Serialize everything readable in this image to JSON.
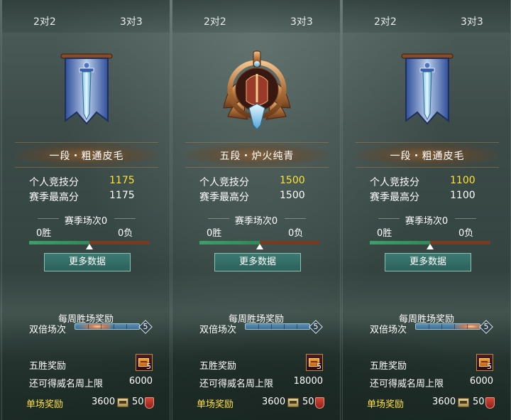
{
  "panels": [
    {
      "tabs": [
        "2对2",
        "3对3"
      ],
      "emblem": "banner-sword-emblem-icon",
      "rank_name": "一段・粗通皮毛",
      "personal_score_label": "个人竞技分",
      "personal_score": "1175",
      "season_best_label": "赛季最高分",
      "season_best": "1175",
      "season_matches": "赛季场次0",
      "wins": "0胜",
      "losses": "0负",
      "more_button": "更多数据",
      "weekly_title": "每周胜场奖励",
      "double_label": "双倍场次",
      "double_count": "5",
      "five_win_label": "五胜奖励",
      "chest_count": "5",
      "limit_label": "还可得威名周上限",
      "limit_value": "6000",
      "single_label": "单场奖励",
      "single_value1": "3600",
      "single_value2": "50"
    },
    {
      "tabs": [
        "2对2",
        "3对3"
      ],
      "emblem": "winged-bronze-emblem-icon",
      "rank_name": "五段・炉火纯青",
      "personal_score_label": "个人竞技分",
      "personal_score": "1500",
      "season_best_label": "赛季最高分",
      "season_best": "1500",
      "season_matches": "赛季场次0",
      "wins": "0胜",
      "losses": "0负",
      "more_button": "更多数据",
      "weekly_title": "每周胜场奖励",
      "double_label": "双倍场次",
      "double_count": "5",
      "five_win_label": "五胜奖励",
      "chest_count": "5",
      "limit_label": "还可得威名周上限",
      "limit_value": "18000",
      "single_label": "单场奖励",
      "single_value1": "3600",
      "single_value2": "50"
    },
    {
      "tabs": [
        "2对2",
        "3对3"
      ],
      "emblem": "banner-sword-emblem-icon",
      "rank_name": "一段・粗通皮毛",
      "personal_score_label": "个人竞技分",
      "personal_score": "1100",
      "season_best_label": "赛季最高分",
      "season_best": "1100",
      "season_matches": "赛季场次0",
      "wins": "0胜",
      "losses": "0负",
      "more_button": "更多数据",
      "weekly_title": "每周胜场奖励",
      "double_label": "双倍场次",
      "double_count": "5",
      "five_win_label": "五胜奖励",
      "chest_count": "5",
      "limit_label": "还可得威名周上限",
      "limit_value": "6000",
      "single_label": "单场奖励",
      "single_value1": "3600",
      "single_value2": "50"
    }
  ],
  "colors": {
    "highlight_yellow": "#ffe23a",
    "win_green": "#3aa06a",
    "loss_red": "#7a3a22",
    "button_teal": "#2c625b"
  },
  "ratio_win_fraction": 0.5
}
